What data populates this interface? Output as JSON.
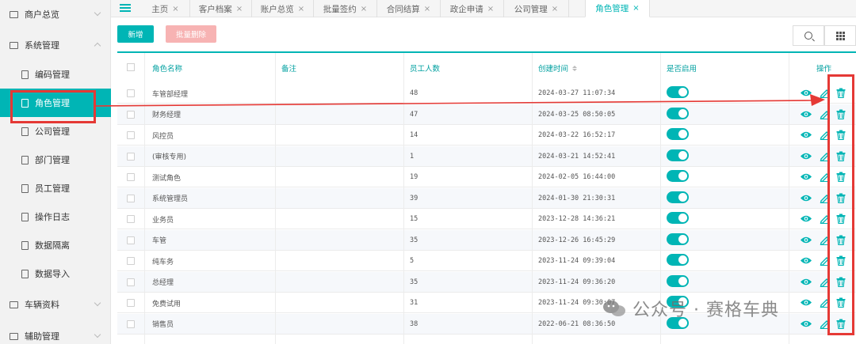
{
  "sidebar": {
    "items": [
      {
        "label": "商户总览",
        "type": "group",
        "expanded": false
      },
      {
        "label": "系统管理",
        "type": "group",
        "expanded": true
      },
      {
        "label": "编码管理",
        "type": "sub"
      },
      {
        "label": "角色管理",
        "type": "sub",
        "active": true
      },
      {
        "label": "公司管理",
        "type": "sub"
      },
      {
        "label": "部门管理",
        "type": "sub"
      },
      {
        "label": "员工管理",
        "type": "sub"
      },
      {
        "label": "操作日志",
        "type": "sub"
      },
      {
        "label": "数据隔离",
        "type": "sub"
      },
      {
        "label": "数据导入",
        "type": "sub"
      },
      {
        "label": "车辆资料",
        "type": "group",
        "expanded": false
      },
      {
        "label": "辅助管理",
        "type": "group",
        "expanded": false
      }
    ]
  },
  "tabs": [
    {
      "label": "主页"
    },
    {
      "label": "客户档案"
    },
    {
      "label": "账户总览"
    },
    {
      "label": "批量签约"
    },
    {
      "label": "合同结算"
    },
    {
      "label": "政企申请"
    },
    {
      "label": "公司管理"
    },
    {
      "label": "角色管理",
      "active": true
    }
  ],
  "toolbar": {
    "add_label": "新增",
    "batch_delete_label": "批量删除"
  },
  "table": {
    "headers": {
      "name": "角色名称",
      "remark": "备注",
      "count": "员工人数",
      "created": "创建时间",
      "enabled": "是否启用",
      "actions": "操作"
    },
    "rows": [
      {
        "name": "车管部经理",
        "remark": "",
        "count": "48",
        "created": "2024-03-27 11:07:34",
        "enabled": true
      },
      {
        "name": "财务经理",
        "remark": "",
        "count": "47",
        "created": "2024-03-25 08:50:05",
        "enabled": true
      },
      {
        "name": "风控员",
        "remark": "",
        "count": "14",
        "created": "2024-03-22 16:52:17",
        "enabled": true
      },
      {
        "name": "(审核专用)",
        "remark": "",
        "count": "1",
        "created": "2024-03-21 14:52:41",
        "enabled": true
      },
      {
        "name": "测试角色",
        "remark": "",
        "count": "19",
        "created": "2024-02-05 16:44:00",
        "enabled": true
      },
      {
        "name": "系统管理员",
        "remark": "",
        "count": "39",
        "created": "2024-01-30 21:30:31",
        "enabled": true
      },
      {
        "name": "业务员",
        "remark": "",
        "count": "15",
        "created": "2023-12-28 14:36:21",
        "enabled": true
      },
      {
        "name": "车管",
        "remark": "",
        "count": "35",
        "created": "2023-12-26 16:45:29",
        "enabled": true
      },
      {
        "name": "纯车务",
        "remark": "",
        "count": "5",
        "created": "2023-11-24 09:39:04",
        "enabled": true
      },
      {
        "name": "总经理",
        "remark": "",
        "count": "35",
        "created": "2023-11-24 09:36:20",
        "enabled": true
      },
      {
        "name": "免费试用",
        "remark": "",
        "count": "31",
        "created": "2023-11-24 09:30:07",
        "enabled": true
      },
      {
        "name": "销售员",
        "remark": "",
        "count": "38",
        "created": "2022-06-21 08:36:50",
        "enabled": true
      }
    ]
  },
  "watermark": {
    "text": "公众号 · 赛格车典"
  },
  "colors": {
    "accent": "#00b5b5",
    "highlight": "#e53935",
    "danger_light": "#f7b3b3"
  }
}
